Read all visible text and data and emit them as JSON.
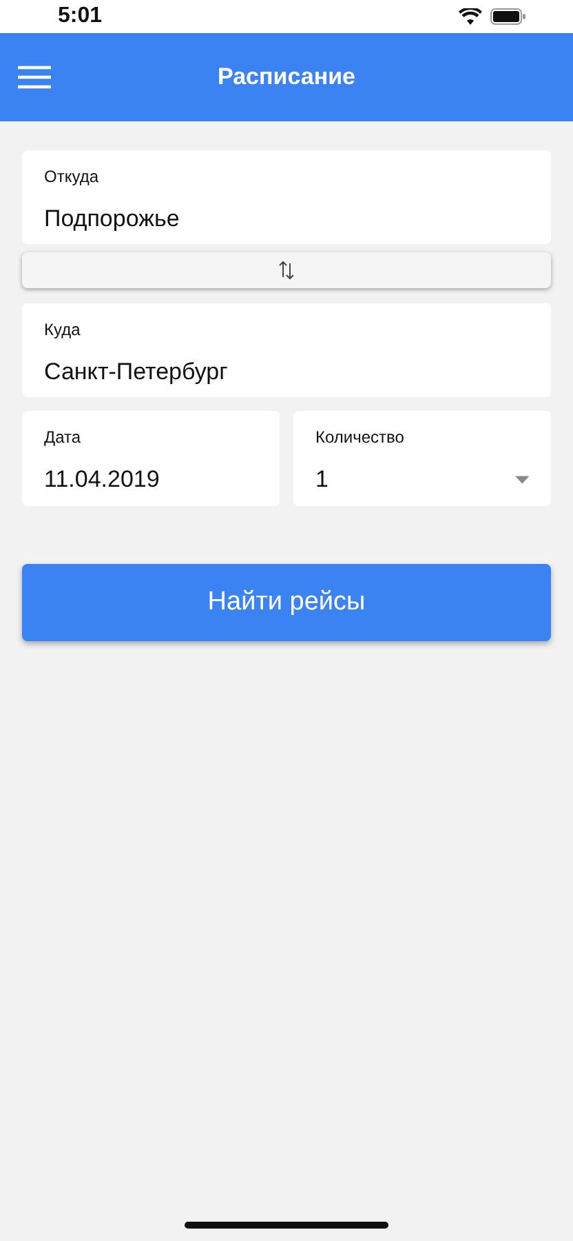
{
  "status_bar": {
    "time": "5:01"
  },
  "header": {
    "title": "Расписание"
  },
  "from": {
    "label": "Откуда",
    "value": "Подпорожье"
  },
  "to": {
    "label": "Куда",
    "value": "Санкт-Петербург"
  },
  "date": {
    "label": "Дата",
    "value": "11.04.2019"
  },
  "count": {
    "label": "Количество",
    "value": "1"
  },
  "search_button": {
    "label": "Найти рейсы"
  }
}
